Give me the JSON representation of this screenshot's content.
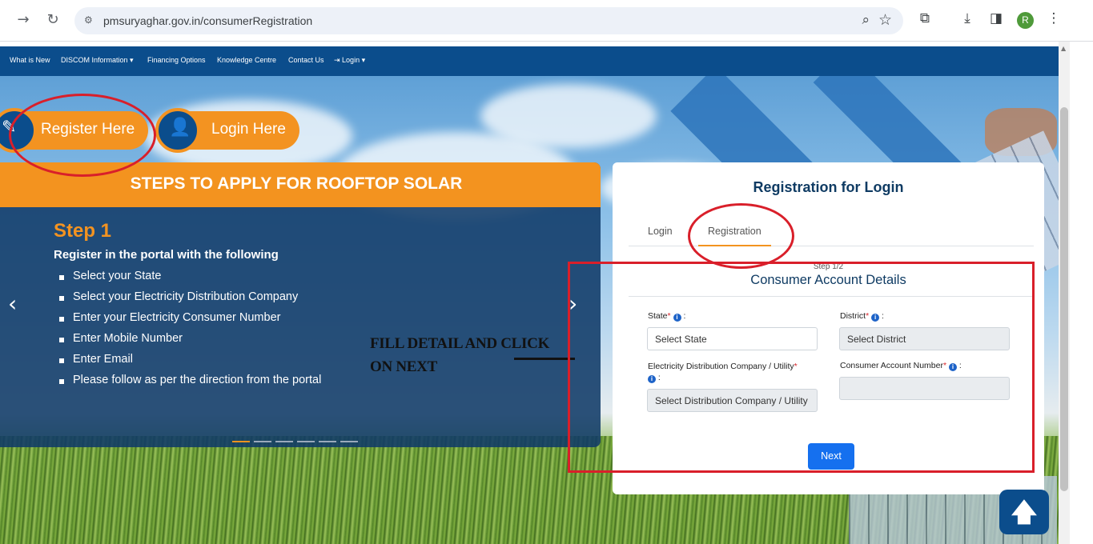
{
  "browser": {
    "url": "pmsuryaghar.gov.in/consumerRegistration",
    "profile_initial": "R",
    "icons": [
      "back-arrow-icon",
      "reload-icon",
      "site-info-icon",
      "zoom-icon",
      "star-icon",
      "extensions-icon",
      "download-icon",
      "sidepanel-icon",
      "menu-icon"
    ]
  },
  "site_nav": {
    "items": [
      {
        "label": "What is New"
      },
      {
        "label": "DISCOM Information"
      },
      {
        "label": "Financing Options"
      },
      {
        "label": "Knowledge Centre"
      },
      {
        "label": "Contact Us"
      },
      {
        "label": "Login"
      }
    ]
  },
  "hero": {
    "register_label": "Register Here",
    "login_label": "Login Here"
  },
  "steps": {
    "heading": "STEPS TO APPLY FOR ROOFTOP SOLAR",
    "step_title": "Step 1",
    "subtitle": "Register in the portal with the following",
    "items": [
      "Select your State",
      "Select your Electricity Distribution Company",
      "Enter your Electricity Consumer Number",
      "Enter Mobile Number",
      "Enter Email",
      "Please follow as per the direction from the portal"
    ],
    "slide_count": 6,
    "active_slide": 1
  },
  "annotation": {
    "line1": "FILL DETAIL AND CLICK",
    "line2": "ON NEXT"
  },
  "registration": {
    "title": "Registration for Login",
    "tabs": [
      {
        "label": "Login",
        "active": false
      },
      {
        "label": "Registration",
        "active": true
      }
    ],
    "step_label": "Step 1/2",
    "section_title": "Consumer Account Details",
    "fields": {
      "state": {
        "label": "State",
        "placeholder": "Select State"
      },
      "district": {
        "label": "District",
        "placeholder": "Select District"
      },
      "discom": {
        "label": "Electricity Distribution Company / Utility",
        "placeholder": "Select Distribution Company / Utility"
      },
      "consumer_no": {
        "label": "Consumer Account Number",
        "value": ""
      }
    },
    "next_label": "Next"
  },
  "colors": {
    "navy": "#0b4d8c",
    "orange": "#f3931f",
    "annotation_red": "#d91f2a",
    "next_blue": "#1570ef"
  }
}
